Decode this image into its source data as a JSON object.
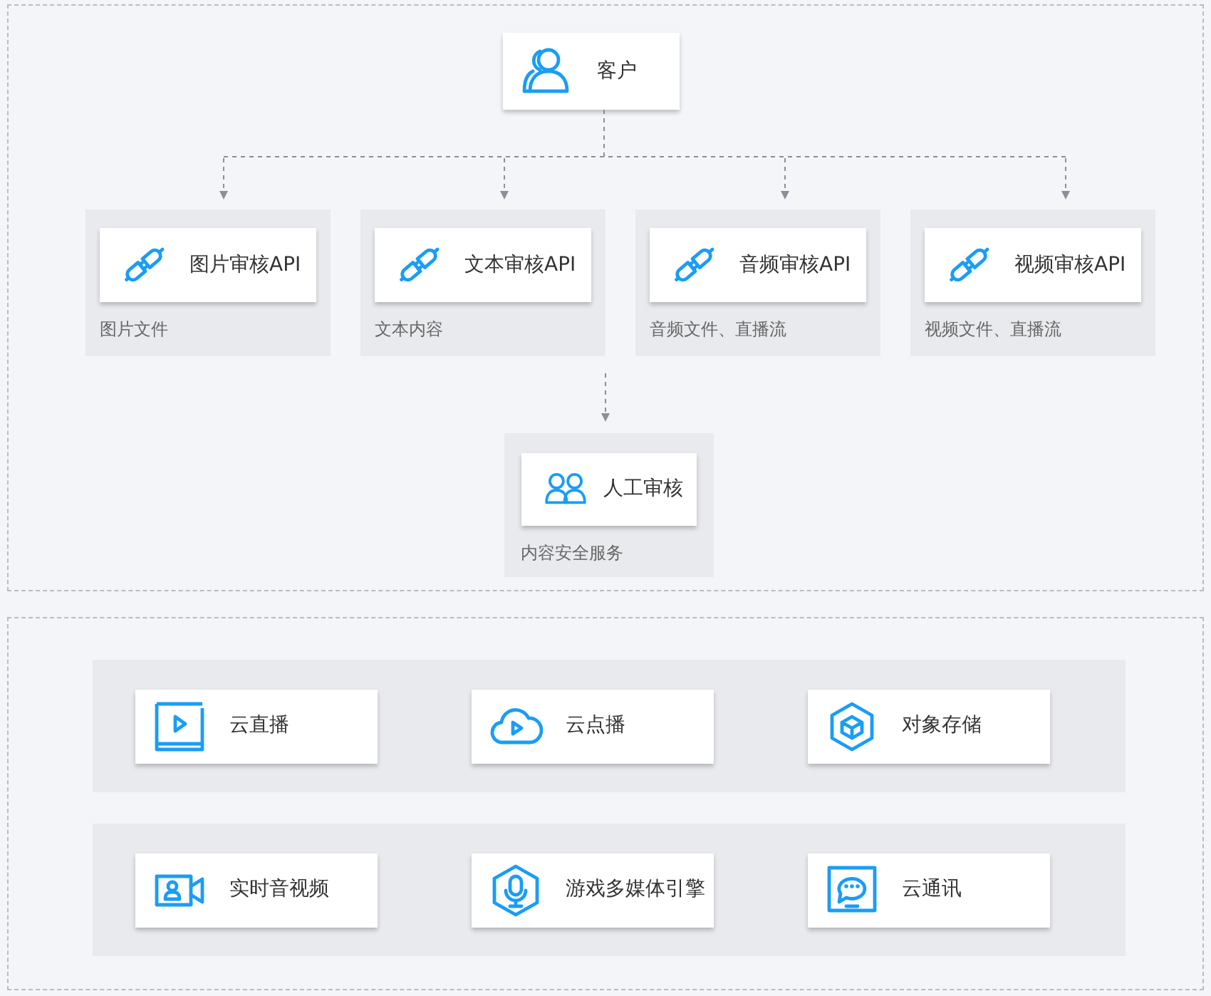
{
  "client": {
    "label": "客户"
  },
  "apis": [
    {
      "label": "图片审核API",
      "caption": "图片文件"
    },
    {
      "label": "文本审核API",
      "caption": "文本内容"
    },
    {
      "label": "音频审核API",
      "caption": "音频文件、直播流"
    },
    {
      "label": "视频审核API",
      "caption": "视频文件、直播流"
    }
  ],
  "manual_review": {
    "label": "人工审核",
    "caption": "内容安全服务"
  },
  "product_rows": [
    [
      {
        "label": "云直播",
        "kind": "live"
      },
      {
        "label": "云点播",
        "kind": "vod"
      },
      {
        "label": "对象存储",
        "kind": "storage"
      }
    ],
    [
      {
        "label": "实时音视频",
        "kind": "rtc"
      },
      {
        "label": "游戏多媒体引擎",
        "kind": "voice"
      },
      {
        "label": "云通讯",
        "kind": "im"
      }
    ]
  ]
}
